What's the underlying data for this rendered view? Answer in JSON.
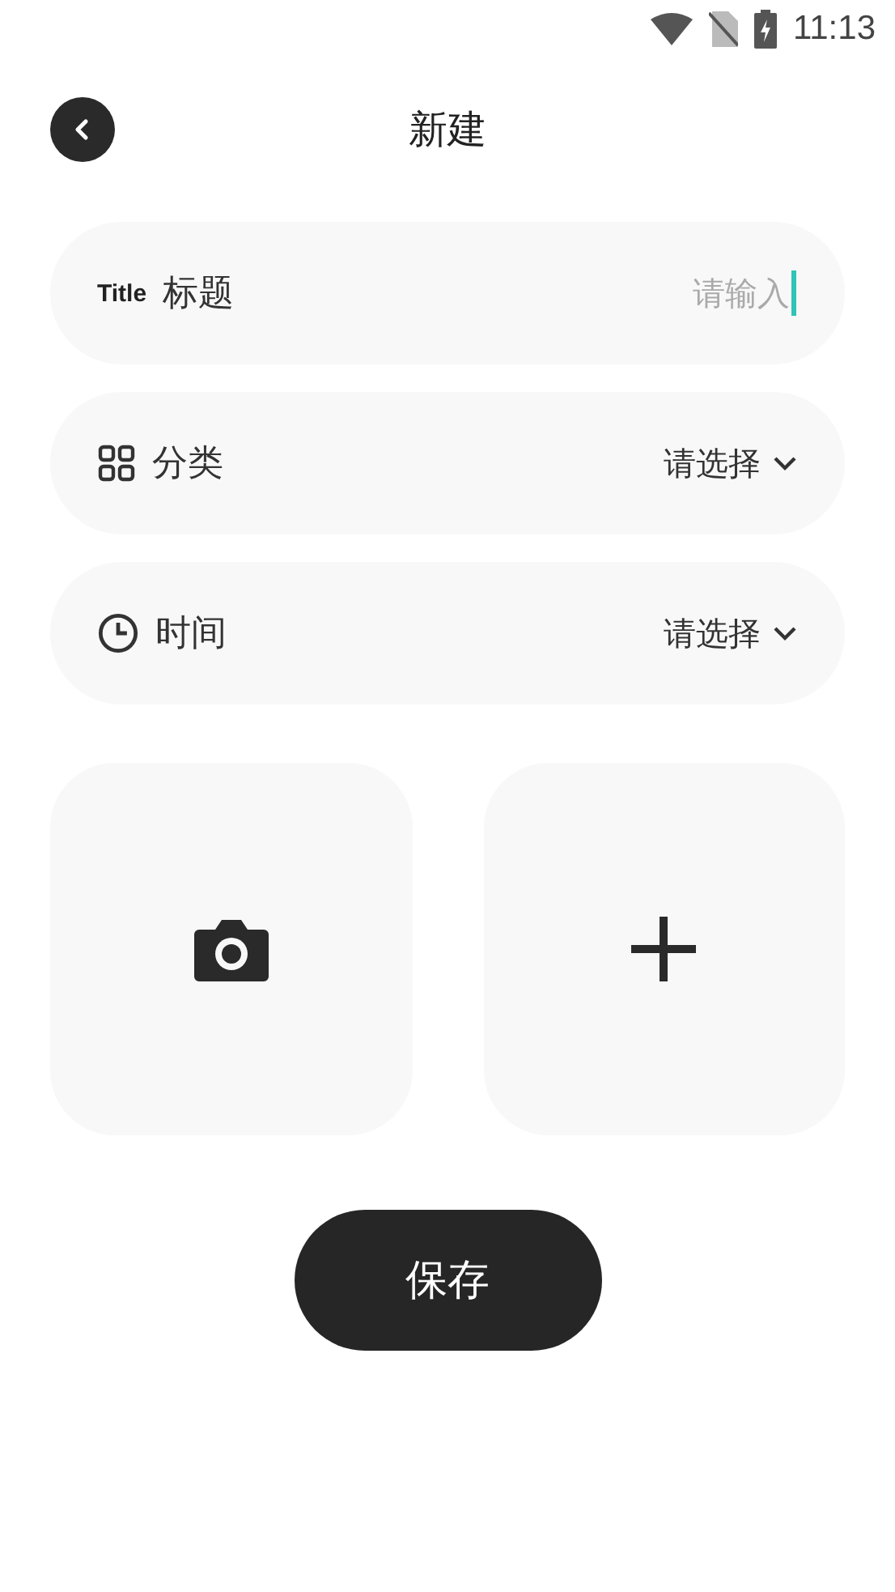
{
  "status_bar": {
    "time": "11:13"
  },
  "header": {
    "title": "新建"
  },
  "fields": [
    {
      "kind": "input",
      "tag": "Title",
      "label": "标题",
      "placeholder": "请输入",
      "focused": true
    },
    {
      "kind": "select",
      "label": "分类",
      "value": "请选择"
    },
    {
      "kind": "select",
      "label": "时间",
      "value": "请选择"
    }
  ],
  "save_button": {
    "label": "保存"
  }
}
